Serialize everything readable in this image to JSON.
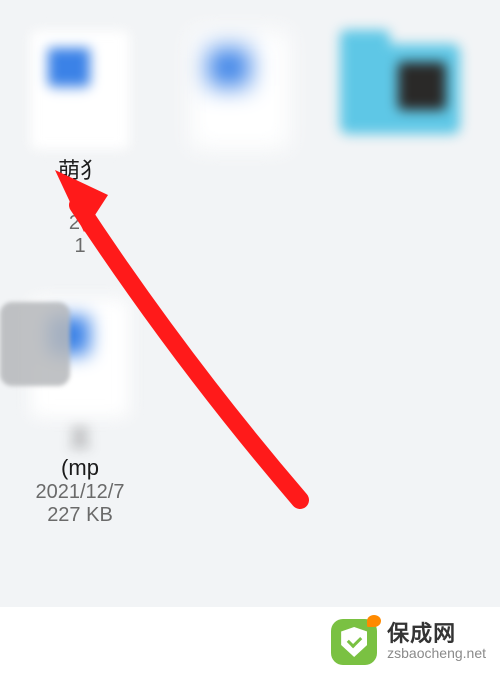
{
  "files": [
    {
      "name": "萌犭",
      "date": "20",
      "size": "1",
      "ext": "",
      "type": "doc"
    },
    {
      "name": "",
      "date": "",
      "size": "",
      "ext": "",
      "type": "doc"
    },
    {
      "name": "",
      "date": "",
      "size": "",
      "ext": "",
      "type": "folder"
    },
    {
      "name": "三",
      "ext": "(mp",
      "date": "2021/12/7",
      "size": "227 KB",
      "type": "doc"
    }
  ],
  "watermark": {
    "brand_cn": "保成网",
    "brand_en": "zsbaocheng.net"
  }
}
